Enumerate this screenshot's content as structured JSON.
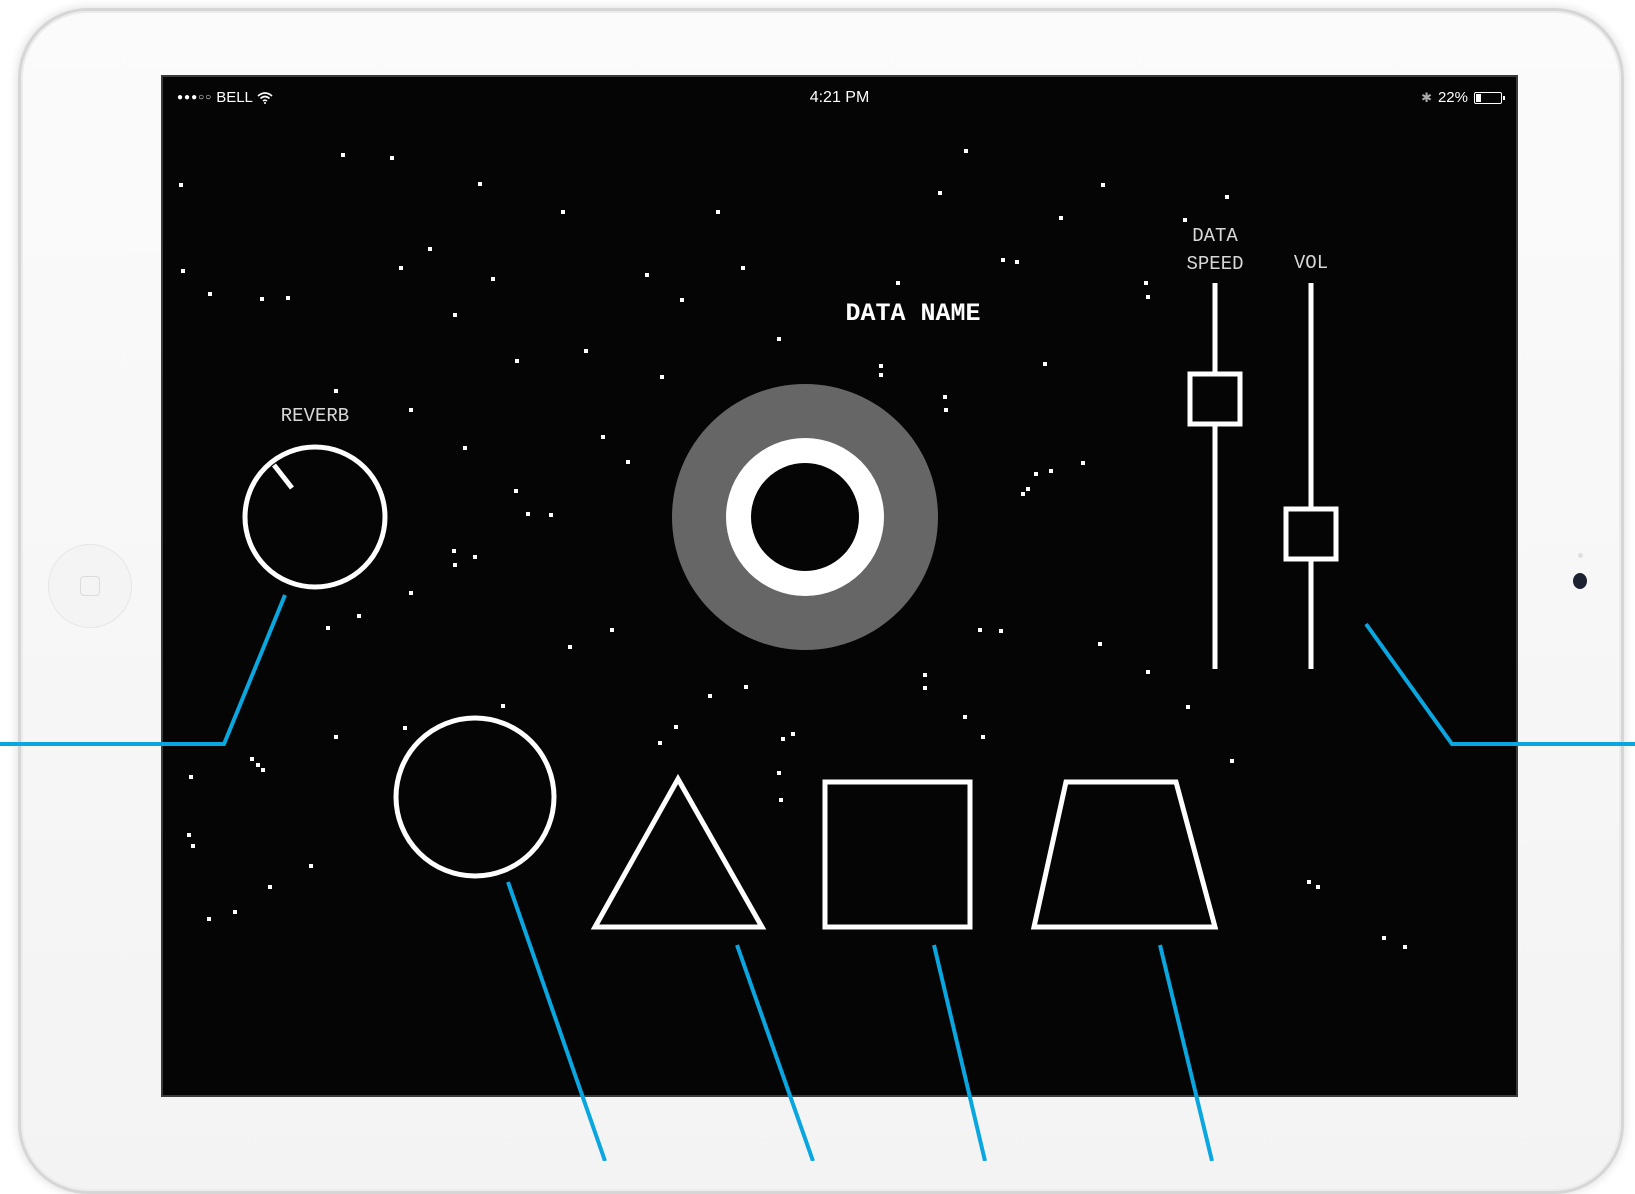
{
  "status_bar": {
    "signal_dots": "●●●○○",
    "carrier": "BELL",
    "wifi_icon": "wifi-icon",
    "time": "4:21 PM",
    "bluetooth_icon": "bluetooth-icon",
    "battery_percent": "22%",
    "battery_level": 0.22
  },
  "title": "DATA NAME",
  "controls": {
    "reverb": {
      "label": "REVERB"
    },
    "data_speed": {
      "label_line1": "DATA",
      "label_line2": "SPEED",
      "level": 0.7
    },
    "vol": {
      "label": "VOL",
      "level": 0.35
    }
  },
  "shapes": [
    "circle",
    "triangle",
    "square",
    "trapezoid"
  ],
  "colors": {
    "screen_background": "#050505",
    "foreground": "#ffffff",
    "ring_grey": "#666666",
    "annotation_blue": "#0aa6e0"
  }
}
